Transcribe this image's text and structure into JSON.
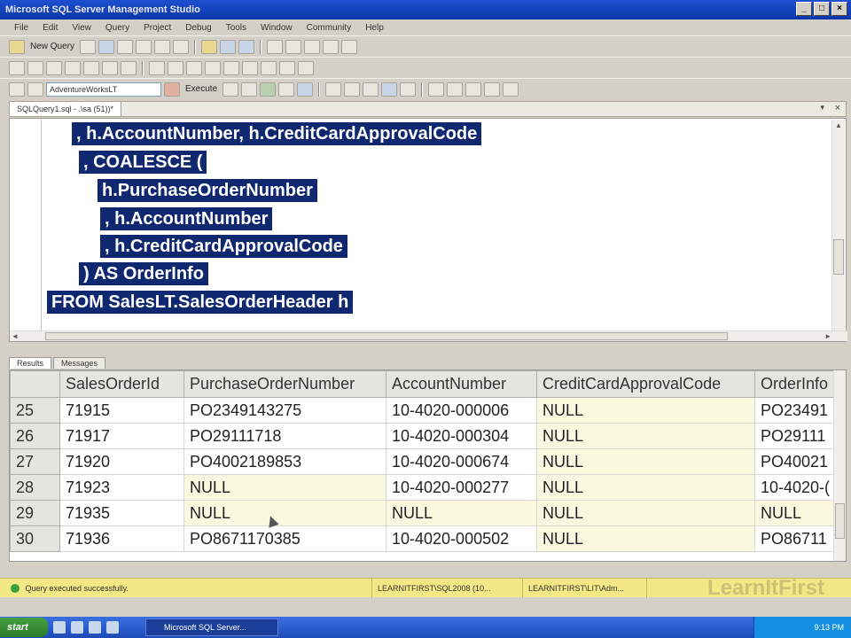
{
  "window": {
    "title": "Microsoft SQL Server Management Studio"
  },
  "menu": [
    "File",
    "Edit",
    "View",
    "Query",
    "Project",
    "Debug",
    "Tools",
    "Window",
    "Community",
    "Help"
  ],
  "toolbar": {
    "new_query": "New Query",
    "database": "AdventureWorksLT",
    "execute": "Execute"
  },
  "doc_tab": {
    "label": "SQLQuery1.sql - .\\sa (51))*"
  },
  "editor": {
    "lines": [
      ", h.AccountNumber, h.CreditCardApprovalCode",
      ", COALESCE (",
      "h.PurchaseOrderNumber",
      ", h.AccountNumber",
      ", h.CreditCardApprovalCode",
      ") AS OrderInfo",
      "FROM SalesLT.SalesOrderHeader h"
    ]
  },
  "results_tabs": {
    "results": "Results",
    "messages": "Messages"
  },
  "grid": {
    "columns": [
      "",
      "SalesOrderId",
      "PurchaseOrderNumber",
      "AccountNumber",
      "CreditCardApprovalCode",
      "OrderInfo"
    ],
    "rows": [
      [
        "25",
        "71915",
        "PO2349143275",
        "10-4020-000006",
        "NULL",
        "PO23491"
      ],
      [
        "26",
        "71917",
        "PO29111718",
        "10-4020-000304",
        "NULL",
        "PO29111"
      ],
      [
        "27",
        "71920",
        "PO4002189853",
        "10-4020-000674",
        "NULL",
        "PO40021"
      ],
      [
        "28",
        "71923",
        "NULL",
        "10-4020-000277",
        "NULL",
        "10-4020-("
      ],
      [
        "29",
        "71935",
        "NULL",
        "NULL",
        "NULL",
        "NULL"
      ],
      [
        "30",
        "71936",
        "PO8671170385",
        "10-4020-000502",
        "NULL",
        "PO86711"
      ]
    ]
  },
  "status": {
    "message": "Query executed successfully.",
    "server": "LEARNITFIRST\\SQL2008 (10...",
    "user": "LEARNITFIRST\\LIT\\Adm..."
  },
  "watermark": "LearnItFirst",
  "taskbar": {
    "start": "start",
    "task": "Microsoft SQL Server...",
    "clock": "9:13 PM"
  }
}
